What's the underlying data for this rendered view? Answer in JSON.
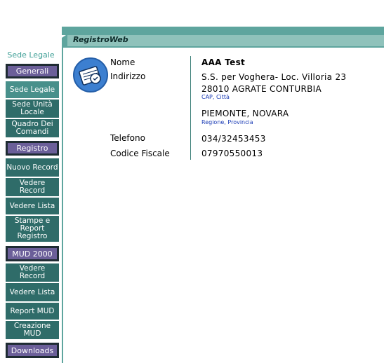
{
  "app": {
    "title": "RegistroWeb"
  },
  "sidebar": {
    "caption": "Sede Legale",
    "items": [
      {
        "label": "Generali",
        "kind": "group"
      },
      {
        "label": "Sede Legale",
        "kind": "item",
        "active": true
      },
      {
        "label": "Sede Unità Locale",
        "kind": "item"
      },
      {
        "label": "Quadro Dei Comandi",
        "kind": "item"
      },
      {
        "label": "Registro",
        "kind": "group"
      },
      {
        "label": "Nuovo Record",
        "kind": "item"
      },
      {
        "label": "Vedere Record",
        "kind": "item"
      },
      {
        "label": "Vedere Lista",
        "kind": "item"
      },
      {
        "label": "Stampe e Report Registro",
        "kind": "item"
      },
      {
        "label": "MUD 2000",
        "kind": "group"
      },
      {
        "label": "Vedere Record",
        "kind": "item"
      },
      {
        "label": "Vedere Lista",
        "kind": "item"
      },
      {
        "label": "Report MUD",
        "kind": "item"
      },
      {
        "label": "Creazione MUD",
        "kind": "item"
      },
      {
        "label": "Downloads",
        "kind": "group"
      }
    ]
  },
  "details": {
    "nome_label": "Nome",
    "nome_value": "AAA Test",
    "indirizzo_label": "Indirizzo",
    "indirizzo_line1": "S.S. per Voghera- Loc. Villoria 23",
    "indirizzo_line2": "28010 AGRATE CONTURBIA",
    "cap_hint": "CAP, Città",
    "region_line": "PIEMONTE, NOVARA",
    "region_hint": "Regione, Provincia",
    "telefono_label": "Telefono",
    "telefono_value": "034/32453453",
    "cf_label": "Codice Fiscale",
    "cf_value": "07970550013"
  },
  "colors": {
    "teal": "#5ea59e",
    "nav_item": "#2f6c69",
    "nav_group": "#6b5f99",
    "logo": "#3c7fd0"
  }
}
